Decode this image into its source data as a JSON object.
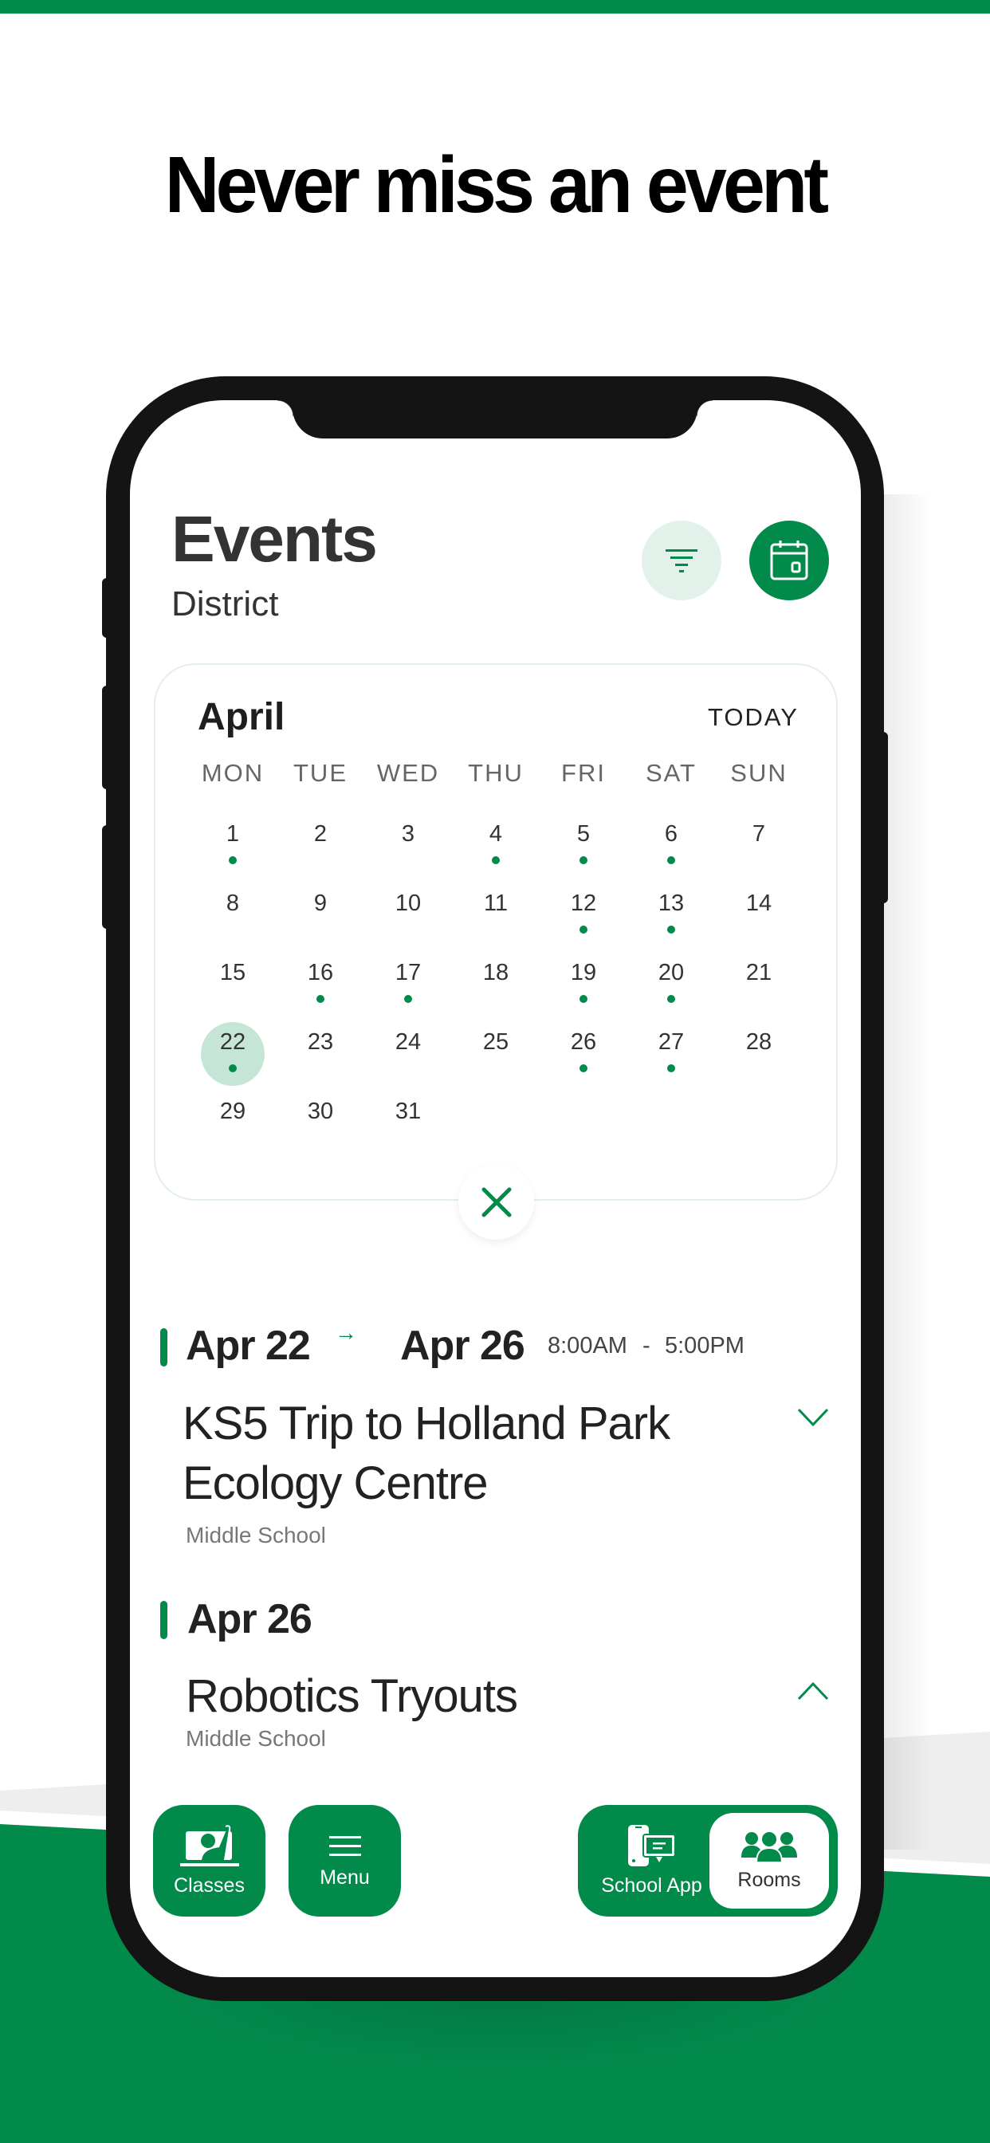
{
  "headline": "Never miss an event",
  "colors": {
    "brand": "#028a4b",
    "brand_light": "#e2f1ea",
    "selected_day": "#c5e5d6"
  },
  "header": {
    "title": "Events",
    "subtitle": "District",
    "filter_icon": "filter-icon",
    "calendar_icon": "calendar-icon"
  },
  "calendar": {
    "month": "April",
    "today_label": "TODAY",
    "weekdays": [
      "MON",
      "TUE",
      "WED",
      "THU",
      "FRI",
      "SAT",
      "SUN"
    ],
    "days": [
      [
        "1",
        "2",
        "3",
        "4",
        "5",
        "6",
        "7"
      ],
      [
        "8",
        "9",
        "10",
        "11",
        "12",
        "13",
        "14"
      ],
      [
        "15",
        "16",
        "17",
        "18",
        "19",
        "20",
        "21"
      ],
      [
        "22",
        "23",
        "24",
        "25",
        "26",
        "27",
        "28"
      ],
      [
        "29",
        "30",
        "31",
        "",
        "",
        "",
        ""
      ]
    ],
    "event_days": [
      1,
      4,
      5,
      6,
      12,
      13,
      16,
      17,
      19,
      20,
      22,
      26,
      27
    ],
    "selected_day": 22,
    "close_icon": "close-icon"
  },
  "events": [
    {
      "start_date": "Apr 22",
      "arrow": "→",
      "end_date": "Apr 26",
      "start_time": "8:00AM",
      "time_sep": "-",
      "end_time": "5:00PM",
      "title_line1": "KS5 Trip to Holland Park",
      "title_line2": "Ecology Centre",
      "audience": "Middle School",
      "expanded": false
    },
    {
      "date": "Apr 26",
      "title": "Robotics Tryouts",
      "audience": "Middle School",
      "expanded": true
    }
  ],
  "bottom_nav": {
    "classes": "Classes",
    "menu": "Menu",
    "school_app": "School App",
    "rooms": "Rooms",
    "active": "Rooms"
  }
}
